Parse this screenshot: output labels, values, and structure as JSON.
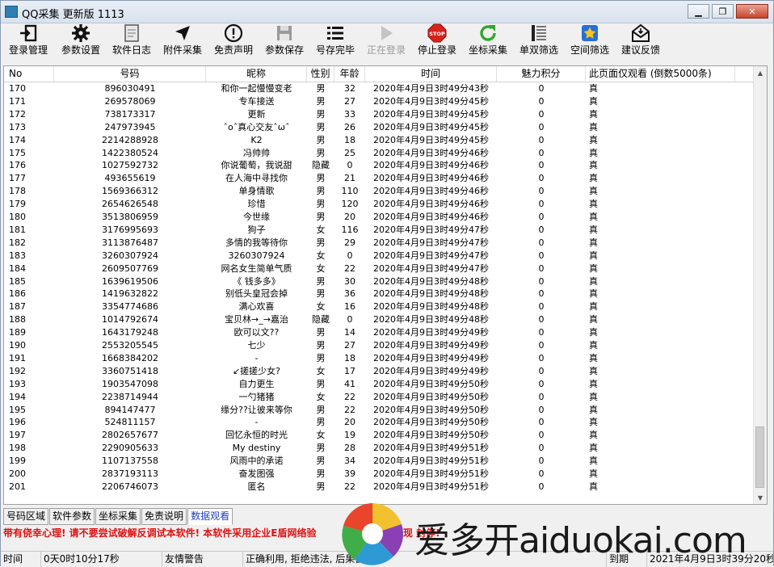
{
  "window": {
    "title": "QQ采集 更新版 1113",
    "minimize": "▁",
    "restore": "❐",
    "close": "✕"
  },
  "toolbar": [
    {
      "label": "登录管理",
      "icon": "login-icon"
    },
    {
      "label": "参数设置",
      "icon": "gear-icon"
    },
    {
      "label": "软件日志",
      "icon": "log-icon"
    },
    {
      "label": "附件采集",
      "icon": "cursor-icon"
    },
    {
      "label": "免责声明",
      "icon": "info-icon"
    },
    {
      "label": "参数保存",
      "icon": "save-icon"
    },
    {
      "label": "号存完毕",
      "icon": "list-icon"
    },
    {
      "label": "正在登录",
      "icon": "play-icon",
      "disabled": true
    },
    {
      "label": "停止登录",
      "icon": "stop-icon"
    },
    {
      "label": "坐标采集",
      "icon": "refresh-icon"
    },
    {
      "label": "单双筛选",
      "icon": "filter-icon"
    },
    {
      "label": "空间筛选",
      "icon": "star-icon"
    },
    {
      "label": "建议反馈",
      "icon": "mail-icon"
    }
  ],
  "table": {
    "columns": [
      "No",
      "号码",
      "昵称",
      "性别",
      "年龄",
      "时间",
      "魅力积分",
      "此页面仅观看 (倒数5000条)"
    ],
    "rows": [
      [
        "170",
        "896030491",
        "和你一起慢慢变老",
        "男",
        "32",
        "2020年4月9日3时49分43秒",
        "0",
        "真"
      ],
      [
        "171",
        "269578069",
        "专车接送",
        "男",
        "27",
        "2020年4月9日3时49分45秒",
        "0",
        "真"
      ],
      [
        "172",
        "738173317",
        "更新",
        "男",
        "33",
        "2020年4月9日3时49分45秒",
        "0",
        "真"
      ],
      [
        "173",
        "247973945",
        "ˆoˆ真心交友ˆωˆ",
        "男",
        "26",
        "2020年4月9日3时49分45秒",
        "0",
        "真"
      ],
      [
        "174",
        "2214288928",
        "K2",
        "男",
        "18",
        "2020年4月9日3时49分45秒",
        "0",
        "真"
      ],
      [
        "175",
        "1422380524",
        "冯帅帅",
        "男",
        "25",
        "2020年4月9日3时49分46秒",
        "0",
        "真"
      ],
      [
        "176",
        "1027592732",
        "你说葡萄，我说甜",
        "隐藏",
        "0",
        "2020年4月9日3时49分46秒",
        "0",
        "真"
      ],
      [
        "177",
        "493655619",
        "在人海中寻找你",
        "男",
        "21",
        "2020年4月9日3时49分46秒",
        "0",
        "真"
      ],
      [
        "178",
        "1569366312",
        "单身情歌",
        "男",
        "110",
        "2020年4月9日3时49分46秒",
        "0",
        "真"
      ],
      [
        "179",
        "2654626548",
        "珍惜",
        "男",
        "120",
        "2020年4月9日3时49分46秒",
        "0",
        "真"
      ],
      [
        "180",
        "3513806959",
        "今世缘",
        "男",
        "20",
        "2020年4月9日3时49分46秒",
        "0",
        "真"
      ],
      [
        "181",
        "3176995693",
        "狗子",
        "女",
        "116",
        "2020年4月9日3时49分47秒",
        "0",
        "真"
      ],
      [
        "182",
        "3113876487",
        "多情的我等待你",
        "男",
        "29",
        "2020年4月9日3时49分47秒",
        "0",
        "真"
      ],
      [
        "183",
        "3260307924",
        "3260307924",
        "女",
        "0",
        "2020年4月9日3时49分47秒",
        "0",
        "真"
      ],
      [
        "184",
        "2609507769",
        "网名女生简单气质",
        "女",
        "22",
        "2020年4月9日3时49分47秒",
        "0",
        "真"
      ],
      [
        "185",
        "1639619506",
        "《  钱多多》",
        "男",
        "30",
        "2020年4月9日3时49分48秒",
        "0",
        "真"
      ],
      [
        "186",
        "1419632822",
        "别低头皇冠会掉",
        "男",
        "36",
        "2020年4月9日3时49分48秒",
        "0",
        "真"
      ],
      [
        "187",
        "3354774686",
        "满心欢喜",
        "女",
        "16",
        "2020年4月9日3时49分48秒",
        "0",
        "真"
      ],
      [
        "188",
        "1014792674",
        "宝贝林→_→嘉治",
        "隐藏",
        "0",
        "2020年4月9日3时49分48秒",
        "0",
        "真"
      ],
      [
        "189",
        "1643179248",
        "欧可以文??",
        "男",
        "14",
        "2020年4月9日3时49分49秒",
        "0",
        "真"
      ],
      [
        "190",
        "2553205545",
        "七少",
        "男",
        "27",
        "2020年4月9日3时49分49秒",
        "0",
        "真"
      ],
      [
        "191",
        "1668384202",
        "-",
        "男",
        "18",
        "2020年4月9日3时49分49秒",
        "0",
        "真"
      ],
      [
        "192",
        "3360751418",
        "↙搓搓少女?",
        "女",
        "17",
        "2020年4月9日3时49分49秒",
        "0",
        "真"
      ],
      [
        "193",
        "1903547098",
        "自力更生",
        "男",
        "41",
        "2020年4月9日3时49分50秒",
        "0",
        "真"
      ],
      [
        "194",
        "2238714944",
        "一勺猪猪",
        "女",
        "22",
        "2020年4月9日3时49分50秒",
        "0",
        "真"
      ],
      [
        "195",
        "894147477",
        "缘分??让彼来等你",
        "男",
        "22",
        "2020年4月9日3时49分50秒",
        "0",
        "真"
      ],
      [
        "196",
        "524811157",
        "-",
        "男",
        "20",
        "2020年4月9日3时49分50秒",
        "0",
        "真"
      ],
      [
        "197",
        "2802657677",
        "回忆永恒的时光",
        "女",
        "19",
        "2020年4月9日3时49分50秒",
        "0",
        "真"
      ],
      [
        "198",
        "2290905633",
        "My  destiny",
        "男",
        "28",
        "2020年4月9日3时49分51秒",
        "0",
        "真"
      ],
      [
        "199",
        "1107137558",
        "风雨中的承诺",
        "男",
        "34",
        "2020年4月9日3时49分51秒",
        "0",
        "真"
      ],
      [
        "200",
        "2837193113",
        "奋发图强",
        "男",
        "39",
        "2020年4月9日3时49分51秒",
        "0",
        "真"
      ],
      [
        "201",
        "2206746073",
        "匿名",
        "男",
        "22",
        "2020年4月9日3时49分51秒",
        "0",
        "真"
      ]
    ]
  },
  "scroll_arrows": {
    "up": "▲",
    "down": "▼"
  },
  "tabs": [
    {
      "label": "号码区域"
    },
    {
      "label": "软件参数"
    },
    {
      "label": "坐标采集"
    },
    {
      "label": "免责说明"
    },
    {
      "label": "数据观看",
      "active": true
    }
  ],
  "warning": {
    "left": "带有侥幸心理! 请不要尝试破解反调试本软件! 本软件采用企业E盾网络验",
    "right": "发现             封停!"
  },
  "status": {
    "time_label": "时间",
    "elapsed": "0天0时10分17秒",
    "notice_label": "友情警告",
    "notice_text": "正确利用, 拒绝违法, 后果自",
    "expire_label": "到期",
    "expire_value": "2021年4月9日3时39分20秒"
  },
  "watermark": {
    "text": "爱多开aiduokai.com",
    "colors": [
      "#f2c12e",
      "#e8452c",
      "#8a3fb4",
      "#2d9ad6",
      "#3fae49"
    ]
  }
}
